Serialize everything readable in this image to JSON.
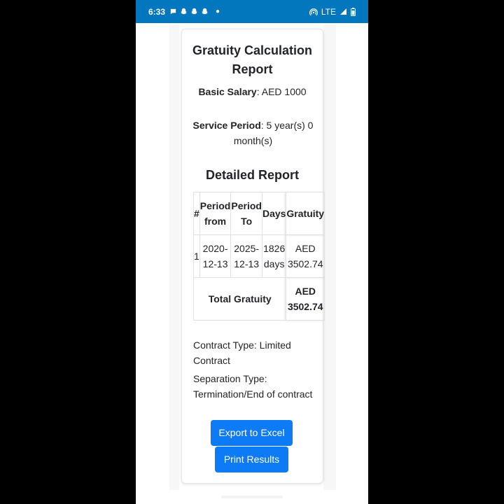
{
  "status_bar": {
    "time": "6:33",
    "network": "LTE",
    "notification_icons": [
      "chat-bubble-icon",
      "snapchat-icon",
      "snapchat-icon",
      "snapchat-icon"
    ]
  },
  "report": {
    "title": "Gratuity Calculation Report",
    "basic_salary_label": "Basic Salary",
    "basic_salary_value": ": AED 1000",
    "service_period_label": "Service Period",
    "service_period_value": ": 5 year(s) 0 month(s)",
    "detailed_title": "Detailed Report",
    "table": {
      "headers": [
        "#",
        "Period from",
        "Period To",
        "Days",
        "Gratuity"
      ],
      "rows": [
        [
          "1",
          "2020-12-13",
          "2025-12-13",
          "1826 days",
          "AED 3502.74"
        ]
      ],
      "total_label": "Total Gratuity",
      "total_value": "AED 3502.74"
    },
    "contract_type": "Contract Type: Limited Contract",
    "separation_type": "Separation Type: Termination/End of contract",
    "export_button": "Export to Excel",
    "print_button": "Print Results"
  },
  "colors": {
    "status_bar": "#0277bd",
    "button": "#0d7bf5"
  }
}
